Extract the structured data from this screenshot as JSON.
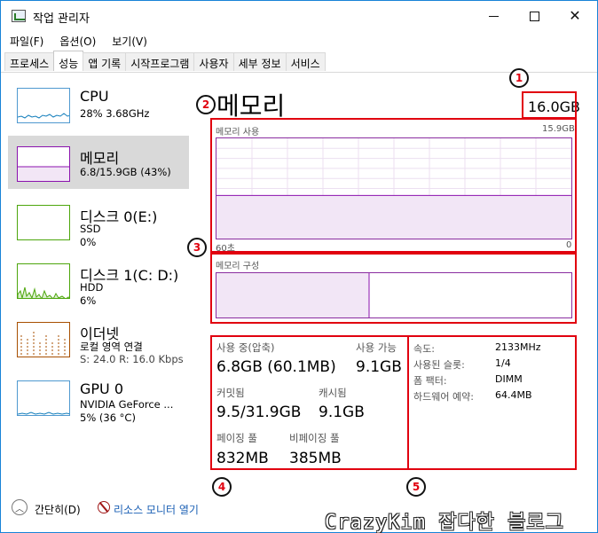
{
  "window": {
    "title": "작업 관리자"
  },
  "menu": [
    "파일(F)",
    "옵션(O)",
    "보기(V)"
  ],
  "tabs": [
    "프로세스",
    "성능",
    "앱 기록",
    "시작프로그램",
    "사용자",
    "세부 정보",
    "서비스"
  ],
  "sidebar": {
    "items": [
      {
        "title": "CPU",
        "line1": "28% 3.68GHz",
        "line2": ""
      },
      {
        "title": "메모리",
        "line1": "6.8/15.9GB (43%)",
        "line2": ""
      },
      {
        "title": "디스크 0(E:)",
        "line1": "SSD",
        "line2": "0%"
      },
      {
        "title": "디스크 1(C: D:)",
        "line1": "HDD",
        "line2": "6%"
      },
      {
        "title": "이더넷",
        "line1": "로컬 영역 연결",
        "line2": "S: 24.0  R: 16.0 Kbps"
      },
      {
        "title": "GPU 0",
        "line1": "NVIDIA GeForce ...",
        "line2": "5% (36 °C)"
      }
    ]
  },
  "main": {
    "title": "메모리",
    "total": "16.0GB",
    "usage_label": "메모리 사용",
    "usage_max": "15.9GB",
    "time_left": "60초",
    "time_right": "0",
    "composition_label": "메모리 구성",
    "usage_fraction": 0.43,
    "composition_fraction": 0.43
  },
  "stats": {
    "in_use_label": "사용 중(압축)",
    "in_use_value": "6.8GB (60.1MB)",
    "available_label": "사용 가능",
    "available_value": "9.1GB",
    "committed_label": "커밋됨",
    "committed_value": "9.5/31.9GB",
    "cached_label": "캐시됨",
    "cached_value": "9.1GB",
    "paged_label": "페이징 풀",
    "paged_value": "832MB",
    "nonpaged_label": "비페이징 풀",
    "nonpaged_value": "385MB"
  },
  "info": {
    "speed_label": "속도:",
    "speed_value": "2133MHz",
    "slots_label": "사용된 슬롯:",
    "slots_value": "1/4",
    "form_label": "폼 팩터:",
    "form_value": "DIMM",
    "reserved_label": "하드웨어 예약:",
    "reserved_value": "64.4MB"
  },
  "badges": [
    "1",
    "2",
    "3",
    "4",
    "5"
  ],
  "footer": {
    "fewer": "간단히(D)",
    "resource_monitor": "리소스 모니터 열기"
  },
  "watermark": "CrazyKim 잡다한 블로그",
  "colors": {
    "memory": "#8b12ae",
    "cpu": "#117dbb",
    "disk": "#4da60c",
    "network": "#a74f01",
    "accent": "#e1000f"
  }
}
